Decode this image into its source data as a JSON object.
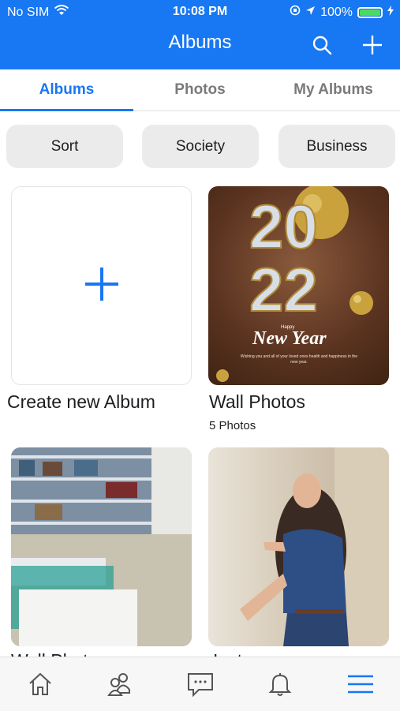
{
  "status_bar": {
    "carrier": "No SIM",
    "time": "10:08 PM",
    "battery_percent": "100%",
    "battery_level": 1.0,
    "battery_color": "#4cd964"
  },
  "header": {
    "title": "Albums",
    "search_icon": "search-icon",
    "add_icon": "plus-icon",
    "background": "#1877f2"
  },
  "tabs": [
    {
      "label": "Albums",
      "active": true
    },
    {
      "label": "Photos",
      "active": false
    },
    {
      "label": "My Albums",
      "active": false
    }
  ],
  "filters": [
    {
      "label": "Sort"
    },
    {
      "label": "Society"
    },
    {
      "label": "Business"
    }
  ],
  "albums": [
    {
      "name": "Create new Album",
      "count": ""
    },
    {
      "name": "Wall Photos",
      "count": "5 Photos",
      "cover_text": {
        "year_a": "20",
        "year_b": "22",
        "greeting": "New Year",
        "small": "Happy",
        "message": "Wishing you and all of your loved ones health and happiness in the new year."
      }
    },
    {
      "name": "Wall Photos",
      "count": ""
    },
    {
      "name": "Instagram",
      "count": ""
    }
  ],
  "tabbar": [
    {
      "icon": "home-icon",
      "active": false
    },
    {
      "icon": "friends-icon",
      "active": false
    },
    {
      "icon": "chat-icon",
      "active": false
    },
    {
      "icon": "bell-icon",
      "active": false
    },
    {
      "icon": "menu-icon",
      "active": true
    }
  ],
  "accent": "#1877f2"
}
